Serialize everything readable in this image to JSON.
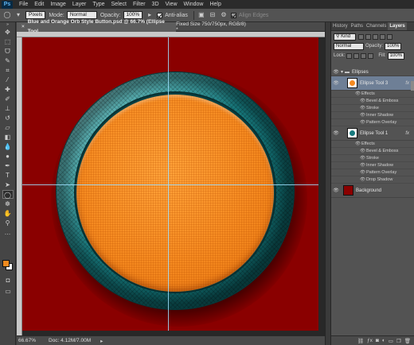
{
  "menu": {
    "logo": "Ps",
    "items": [
      "File",
      "Edit",
      "Image",
      "Layer",
      "Type",
      "Select",
      "Filter",
      "3D",
      "View",
      "Window",
      "Help"
    ]
  },
  "options": {
    "tool_mode": "Pixels",
    "mode_label": "Mode:",
    "mode_value": "Normal",
    "opacity_label": "Opacity:",
    "opacity_value": "100%",
    "antialias_label": "Anti-alias",
    "align_edges_label": "Align Edges"
  },
  "document": {
    "tab_title": "Blue and Orange Orb Style Button.psd @ 66.7% (Ellipse Tool",
    "info": "Fixed Size 750/750px, RGB/8) *"
  },
  "status": {
    "zoom": "66.67%",
    "doc_size": "Doc: 4.12M/7.00M"
  },
  "panel": {
    "tabs": [
      "History",
      "Paths",
      "Channels",
      "Layers"
    ],
    "active_tab": "Layers",
    "filter_kind": "Kind",
    "blend_mode": "Normal",
    "opacity_label": "Opacity:",
    "opacity_value": "100%",
    "lock_label": "Lock:",
    "fill_label": "Fill:",
    "fill_value": "100%"
  },
  "layers": {
    "group_name": "Ellipses",
    "layer3_name": "Ellipse Tool 3",
    "layer3_effects_label": "Effects",
    "layer3_effects": [
      "Bevel & Emboss",
      "Stroke",
      "Inner Shadow",
      "Pattern Overlay"
    ],
    "layer1_name": "Ellipse Tool 1",
    "layer1_effects_label": "Effects",
    "layer1_effects": [
      "Bevel & Emboss",
      "Stroke",
      "Inner Shadow",
      "Pattern Overlay",
      "Drop Shadow"
    ],
    "background_name": "Background",
    "fx_label": "fx"
  },
  "colors": {
    "canvas": "#8a0000",
    "orange": "#f58a20",
    "teal": "#177a7e",
    "foreground_swatch": "#f08a1e",
    "background_swatch": "#ffffff"
  }
}
